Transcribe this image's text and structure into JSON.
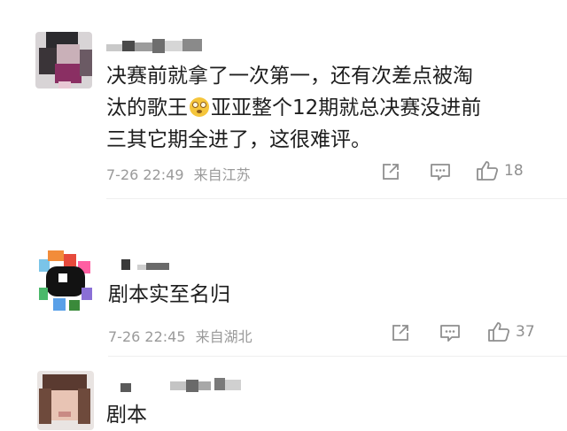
{
  "comments": [
    {
      "text_lines": [
        "决赛前就拿了一次第一，还有次差点被淘",
        "汰的歌王",
        "亚亚整个12期就总决赛没进前",
        "三其它期全进了，这很难评。"
      ],
      "emoji": "astonished-face-emoji",
      "date": "7-26 22:49",
      "location": "来自江苏",
      "like_count": "18"
    },
    {
      "text_lines": [
        "剧本实至名归"
      ],
      "date": "7-26 22:45",
      "location": "来自湖北",
      "like_count": "37"
    },
    {
      "text_lines": [
        "剧本"
      ]
    }
  ],
  "icons": {
    "share": "share-icon",
    "reply": "comment-icon",
    "like": "thumbs-up-icon"
  },
  "colors": {
    "meta_text": "#9a9a9a",
    "body_text": "#1e1e1e",
    "divider": "#efefef"
  }
}
